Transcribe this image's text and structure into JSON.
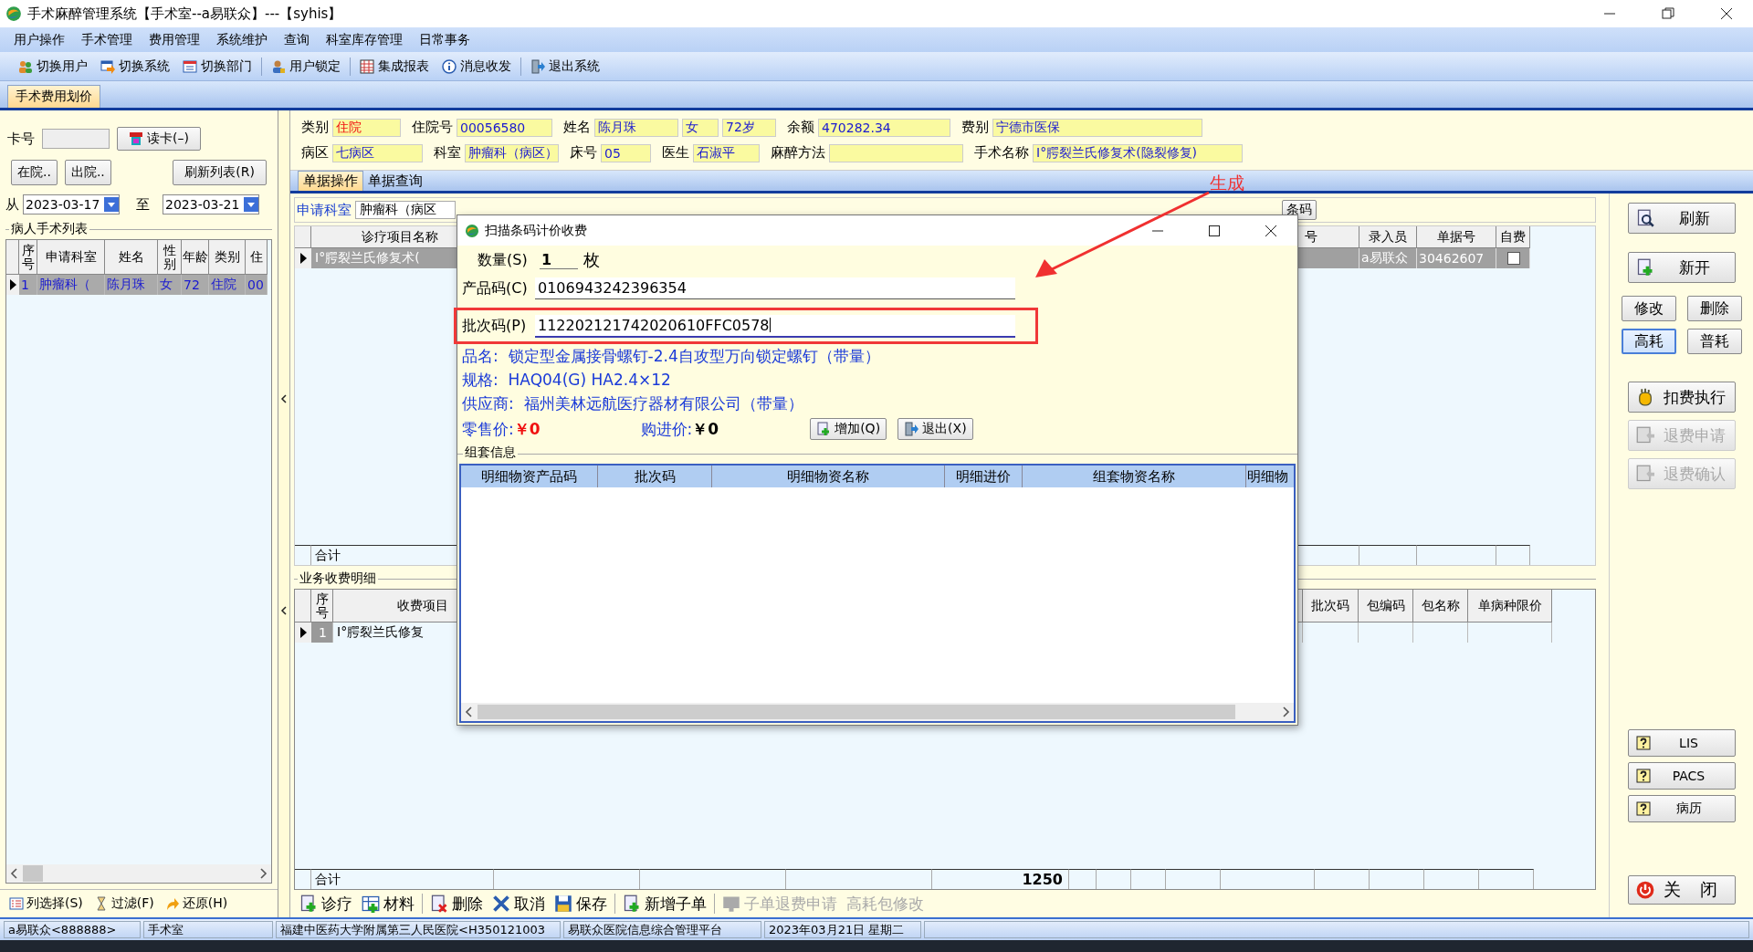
{
  "window": {
    "title": "手术麻醉管理系统【手术室--a易联众】---【syhis】"
  },
  "menu": [
    "用户操作",
    "手术管理",
    "费用管理",
    "系统维护",
    "查询",
    "科室库存管理",
    "日常事务"
  ],
  "toolbar": [
    "切换用户",
    "切换系统",
    "切换部门",
    "用户锁定",
    "集成报表",
    "消息收发",
    "退出系统"
  ],
  "module_tabs": [
    {
      "label": "手术费用划价",
      "selected": true
    }
  ],
  "left_panel": {
    "card_label": "卡号",
    "read_card_button": "读卡(–)",
    "status_buttons": [
      "在院..",
      "出院.."
    ],
    "refresh_button": "刷新列表(R)",
    "from_label": "从",
    "from_date": "2023-03-17",
    "to_label": "至",
    "to_date": "2023-03-21",
    "group_title": "病人手术列表",
    "columns": [
      "序号",
      "申请科室",
      "姓名",
      "性别",
      "年龄",
      "类别",
      "住"
    ],
    "rows": [
      {
        "cells": [
          "1",
          "肿瘤科（",
          "陈月珠",
          "女",
          "72",
          "住院",
          "00"
        ],
        "selected": true
      }
    ],
    "footer_buttons": [
      "列选择(S)",
      "过滤(F)",
      "还原(H)"
    ]
  },
  "patient": {
    "fields": [
      {
        "label": "类别",
        "value": "住院",
        "highlight": true
      },
      {
        "label": "住院号",
        "value": "00056580",
        "highlight": false
      },
      {
        "label": "姓名",
        "value": "陈月珠",
        "highlight": false
      },
      {
        "value": "女",
        "highlight": false
      },
      {
        "value": "72岁",
        "highlight": false
      },
      {
        "label": "余额",
        "value": "470282.34",
        "highlight": false
      },
      {
        "label": "费别",
        "value": "宁德市医保",
        "highlight": false
      },
      {
        "label": "病区",
        "value": "七病区",
        "highlight": false
      },
      {
        "label": "科室",
        "value": "肿瘤科（病区）",
        "highlight": false
      },
      {
        "label": "床号",
        "value": "05",
        "highlight": false
      },
      {
        "label": "医生",
        "value": "石淑平",
        "highlight": false
      },
      {
        "label": "麻醉方法"
      },
      {
        "label": "手术名称",
        "value": "Ⅰ°腭裂兰氏修复术(隐裂修复)",
        "highlight": false
      }
    ]
  },
  "doc_tabs": [
    {
      "label": "单据操作",
      "selected": true
    },
    {
      "label": "单据查询",
      "selected": false
    }
  ],
  "request_dept": {
    "label": "申请科室",
    "value": "肿瘤科（病区"
  },
  "barcode_button": "条码",
  "upper_table": {
    "columns": [
      "诊疗项目名称",
      "号",
      "录入员",
      "单据号",
      "自费"
    ],
    "rows": [
      {
        "item": "Ⅰ°腭裂兰氏修复术(",
        "operator": "a易联众",
        "doc_no": "30462607",
        "self_pay": false,
        "selected": true
      }
    ],
    "total_label": "合计"
  },
  "detail": {
    "title": "业务收费明细",
    "columns": [
      "序号",
      "收费项目",
      "批次码",
      "包编码",
      "包名称",
      "单病种限价"
    ],
    "rows": [
      {
        "number": "1",
        "item": "Ⅰ°腭裂兰氏修复",
        "selected": true
      }
    ],
    "total_label": "合计",
    "total": "1250"
  },
  "bottom_toolbar": [
    {
      "label": "诊疗",
      "disabled": false
    },
    {
      "label": "材料",
      "disabled": false
    },
    {
      "label": "删除",
      "disabled": false
    },
    {
      "label": "取消",
      "disabled": false
    },
    {
      "label": "保存",
      "disabled": false
    },
    {
      "label": "新增子单",
      "disabled": false
    },
    {
      "label": "子单退费申请",
      "disabled": true
    },
    {
      "label": "高耗包修改",
      "disabled": true
    }
  ],
  "right_panel": [
    {
      "buttons": [
        {
          "label": "刷新",
          "kind": "wide",
          "disabled": false
        },
        {
          "label": "新开",
          "kind": "wide",
          "disabled": false
        }
      ]
    },
    {
      "buttons": [
        {
          "label": "修改",
          "kind": "small",
          "disabled": false,
          "selected": false
        },
        {
          "label": "删除",
          "kind": "small",
          "disabled": false,
          "selected": false
        },
        {
          "label": "高耗",
          "kind": "small",
          "disabled": false,
          "selected": true
        },
        {
          "label": "普耗",
          "kind": "small",
          "disabled": false,
          "selected": false
        }
      ]
    },
    {
      "buttons": [
        {
          "label": "扣费执行",
          "kind": "wide",
          "disabled": false
        },
        {
          "label": "退费申请",
          "kind": "wide",
          "disabled": true
        },
        {
          "label": "退费确认",
          "kind": "wide",
          "disabled": true
        }
      ]
    },
    {
      "buttons": [
        {
          "label": "LIS",
          "kind": "help",
          "disabled": false
        },
        {
          "label": "PACS",
          "kind": "help",
          "disabled": false
        },
        {
          "label": "病历",
          "kind": "help",
          "disabled": false
        }
      ]
    },
    {
      "buttons": [
        {
          "label": "关 闭",
          "kind": "close",
          "disabled": false
        }
      ]
    }
  ],
  "dialog": {
    "title": "扫描条码计价收费",
    "quantity_label": "数量(S)",
    "quantity": "1",
    "unit": "枚",
    "product_label": "产品码(C)",
    "product_code": "0106943242396354",
    "batch_label": "批次码(P)",
    "batch_code": "112202121742020610FFC0578",
    "info": [
      {
        "label": "品名:",
        "value": "锁定型金属接骨螺钉-2.4自攻型万向锁定螺钉（带量）"
      },
      {
        "label": "规格:",
        "value": "HAQ04(G) HA2.4×12"
      },
      {
        "label": "供应商:",
        "value": "福州美林远航医疗器材有限公司（带量）"
      }
    ],
    "retail_label": "零售价:",
    "retail_price": "￥0",
    "purchase_label": "购进价:",
    "purchase_price": "￥0",
    "add_button": "增加(Q)",
    "exit_button": "退出(X)",
    "group_title": "组套信息",
    "columns": [
      "明细物资产品码",
      "批次码",
      "明细物资名称",
      "明细进价",
      "组套物资名称",
      "明细物"
    ]
  },
  "annotation": {
    "text": "生成"
  },
  "status_bar": [
    "a易联众<888888>",
    "手术室",
    "福建中医药大学附属第三人民医院<H350121003",
    "易联众医院信息综合管理平台",
    "2023年03月21日 星期二"
  ]
}
